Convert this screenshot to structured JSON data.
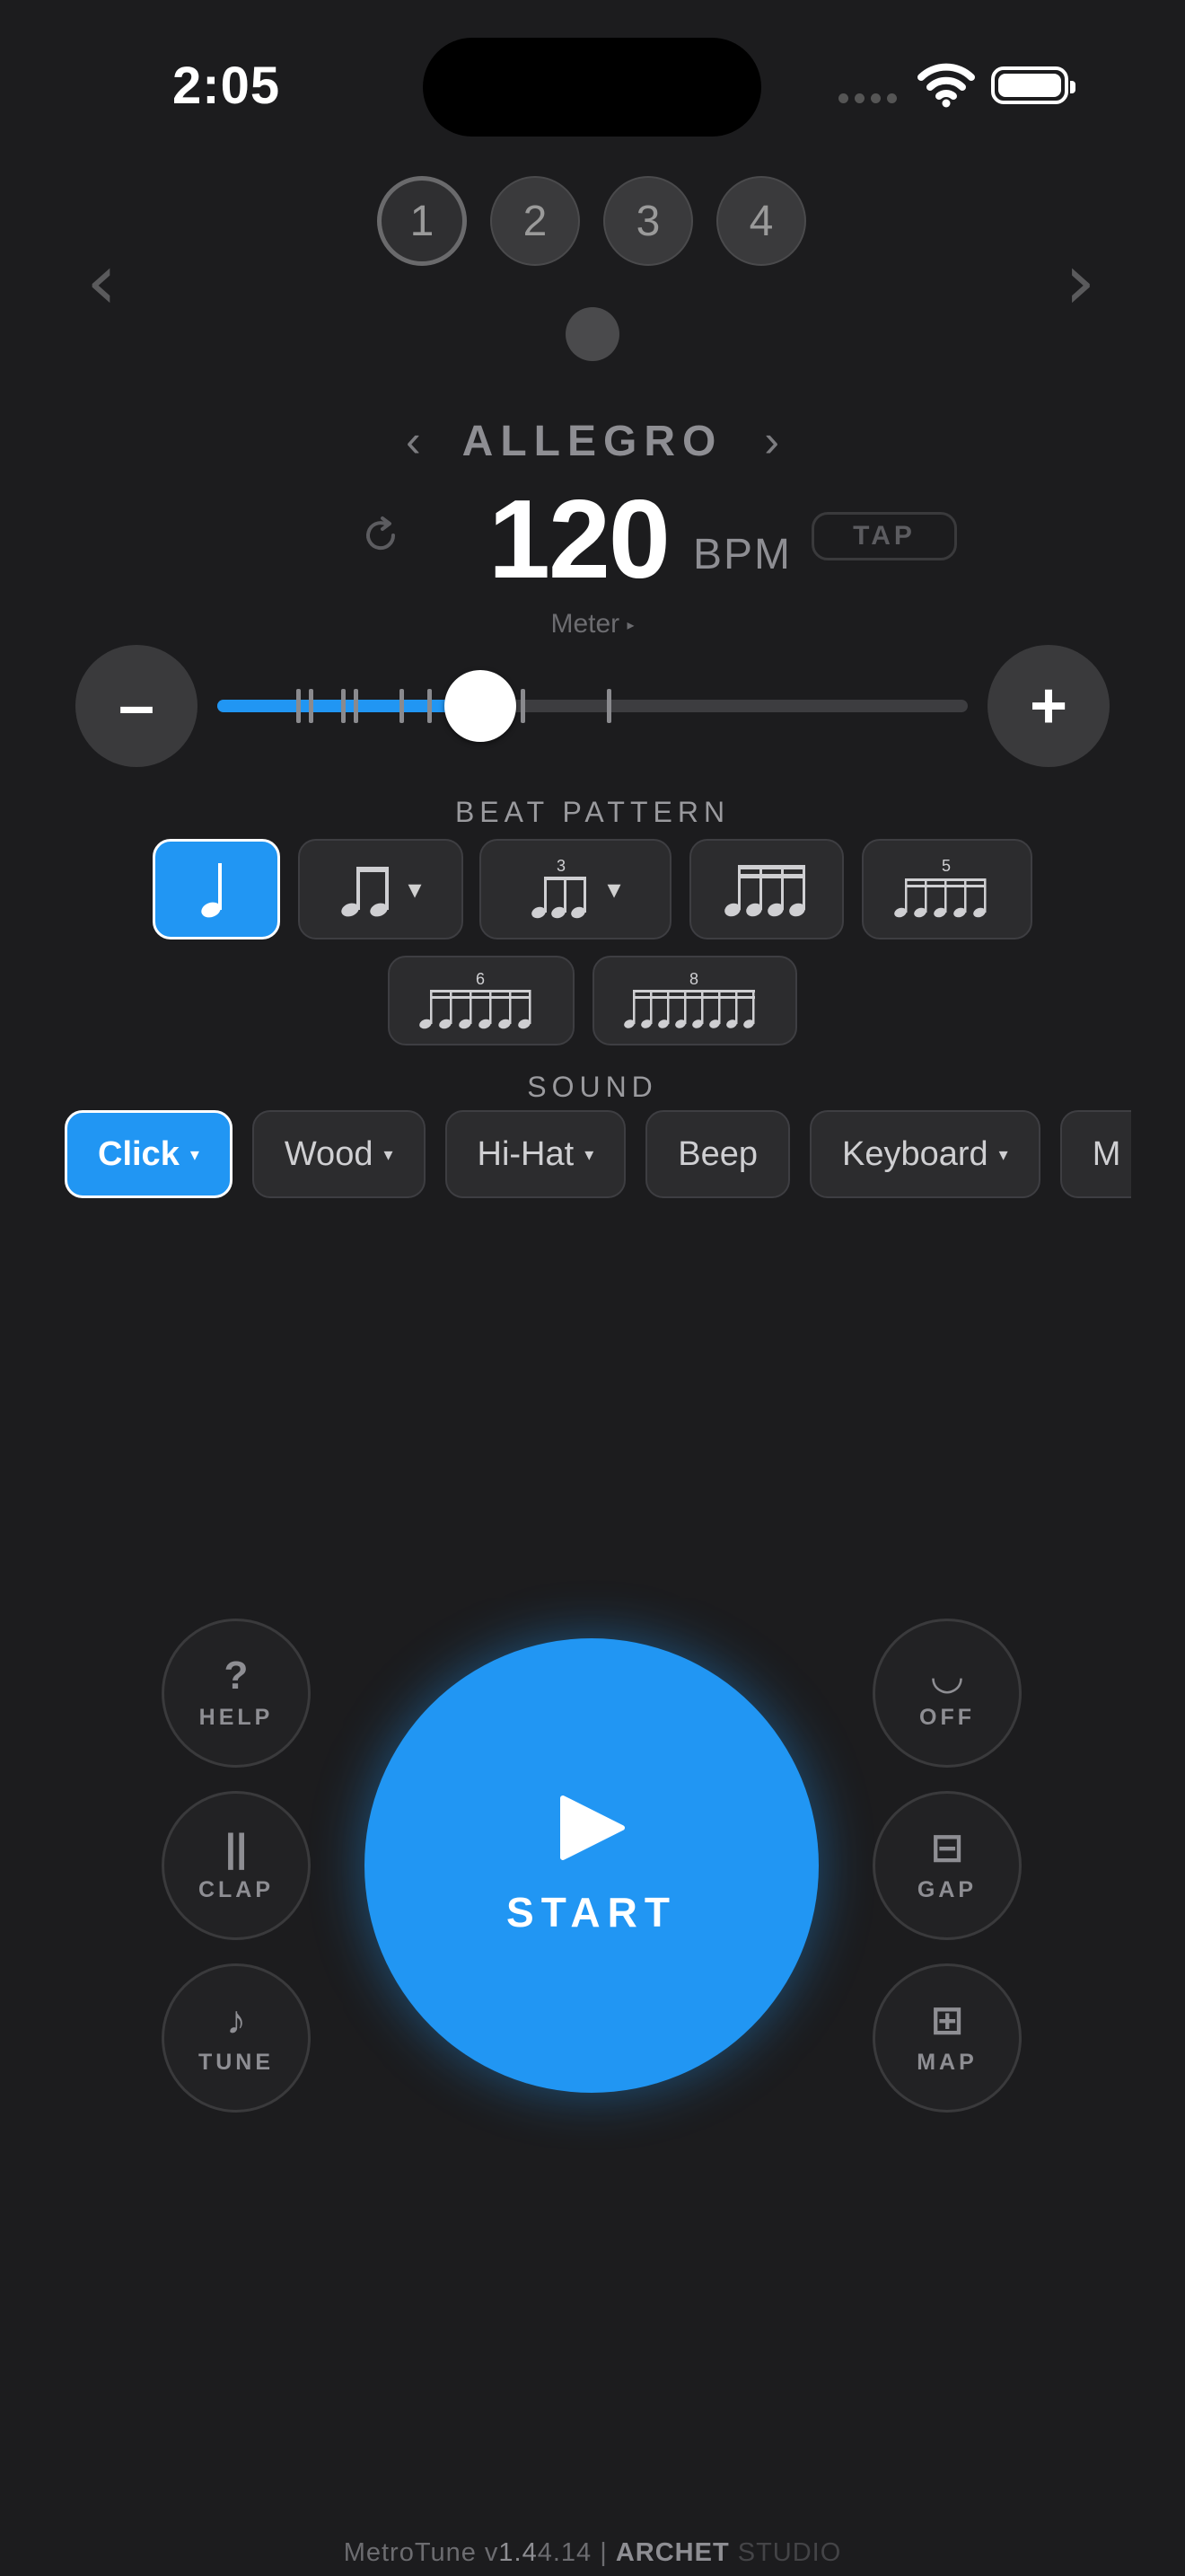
{
  "status_bar": {
    "time": "2:05"
  },
  "presets": [
    "1",
    "2",
    "3",
    "4"
  ],
  "nav": {
    "prev": "‹",
    "next": "›"
  },
  "tempo": {
    "name": "ALLEGRO",
    "prev": "‹",
    "next": "›",
    "bpm": "120",
    "unit": "BPM",
    "tap": "TAP",
    "meter": "Meter",
    "meter_arrow": "▸"
  },
  "slider": {
    "value_fraction": 0.35
  },
  "controls": {
    "minus": "–",
    "plus": "+"
  },
  "beat_pattern": {
    "label": "BEAT PATTERN",
    "triplet_label": "3",
    "quintuplet_label": "5",
    "sextuplet_label": "6",
    "octuplet_label": "8",
    "caret": "▾"
  },
  "sound": {
    "label": "SOUND",
    "options": [
      {
        "label": "Click",
        "caret": "▾"
      },
      {
        "label": "Wood",
        "caret": "▾"
      },
      {
        "label": "Hi-Hat",
        "caret": "▾"
      },
      {
        "label": "Beep",
        "caret": ""
      },
      {
        "label": "Keyboard",
        "caret": "▾"
      },
      {
        "label": "M",
        "caret": ""
      }
    ]
  },
  "start": {
    "label": "START"
  },
  "side_left": [
    {
      "icon": "?",
      "label": "HELP"
    },
    {
      "icon": "||",
      "label": "CLAP"
    },
    {
      "icon": "♪",
      "label": "TUNE"
    }
  ],
  "side_right": [
    {
      "icon": "◡",
      "label": "OFF"
    },
    {
      "icon": "⊟",
      "label": "GAP"
    },
    {
      "icon": "⊞",
      "label": "MAP"
    }
  ],
  "footer": {
    "app": "MetroTune v",
    "ver_hi": "1.4",
    "ver_rest": "4.14 | ",
    "brand": "ARCHET",
    "studio": " STUDIO"
  },
  "colors": {
    "accent": "#2196f3",
    "background": "#1c1c1e"
  }
}
